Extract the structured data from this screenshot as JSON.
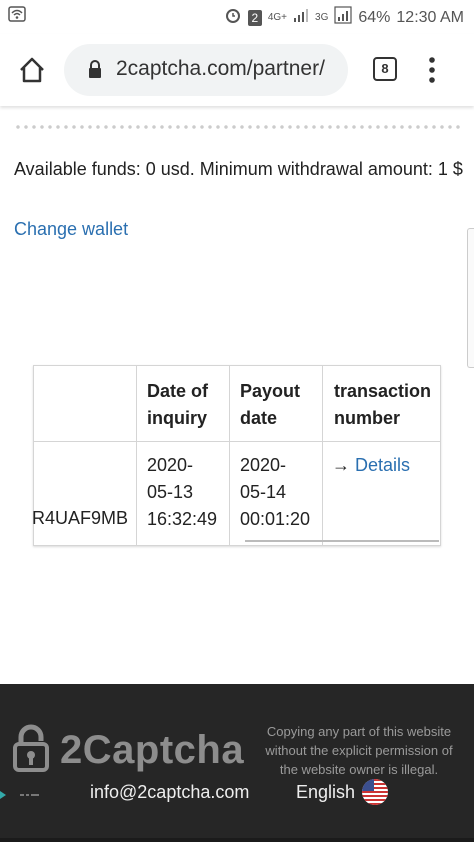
{
  "status_bar": {
    "sim_badge": "2",
    "network_1": "4G+",
    "network_2": "3G",
    "battery": "64%",
    "time": "12:30 AM"
  },
  "browser": {
    "url": "2captcha.com/partner/",
    "tab_count": "8"
  },
  "page": {
    "funds_text": "Available funds: 0 usd. Minimum withdrawal amount: 1 $",
    "change_wallet": "Change wallet"
  },
  "table": {
    "headers": [
      "",
      "Date of inquiry",
      "Payout date",
      "transaction number"
    ],
    "row": {
      "id": "R4UAF9MB",
      "date_inquiry": [
        "2020-",
        "05-13",
        "16:32:49"
      ],
      "payout_date": [
        "2020-",
        "05-14",
        "00:01:20"
      ],
      "details_arrow": "→",
      "details": "Details"
    }
  },
  "footer": {
    "brand": "2Captcha",
    "note": "Copying any part of this website without the explicit permission of the website owner is illegal.",
    "email": "info@2captcha.com",
    "language": "English"
  },
  "colors": {
    "link": "#2a6fb0",
    "footer_bg": "#262626"
  }
}
